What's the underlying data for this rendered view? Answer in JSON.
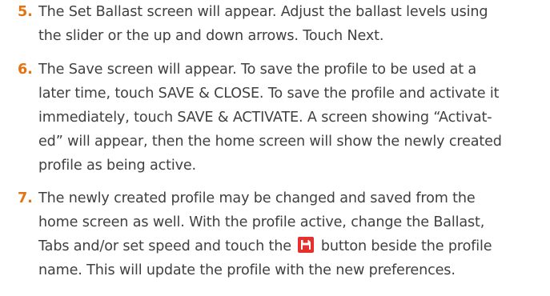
{
  "steps": [
    {
      "number": "5.",
      "lines": [
        "The Set Ballast screen will appear. Adjust the ballast levels using",
        "the slider or the up and down arrows. Touch Next."
      ]
    },
    {
      "number": "6.",
      "lines": [
        "The Save screen will appear. To save the profile to be used at a",
        "later time, touch SAVE & CLOSE.  To save the profile and activate it",
        "immediately, touch SAVE & ACTIVATE.  A screen showing “Activat-",
        "ed” will appear, then the home screen will show the newly created",
        "profile as being active."
      ]
    },
    {
      "number": "7.",
      "lines": [
        "The newly created profile may be changed and saved from the",
        "home screen as well. With the profile active, change the Ballast,"
      ],
      "line3_before_icon": "Tabs and/or set speed and touch the",
      "line3_after_icon": "button beside the profile",
      "line4": "name. This will update the profile with the new preferences."
    }
  ],
  "colors": {
    "step_number": "#e5730f",
    "body_text": "#404040",
    "save_icon_bg": "#e4312d"
  },
  "icons": {
    "save": "save-icon"
  }
}
